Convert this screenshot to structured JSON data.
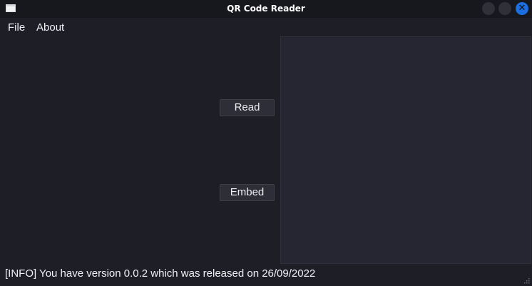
{
  "window": {
    "title": "QR Code Reader"
  },
  "titlebar_buttons": {
    "close_glyph": "✕"
  },
  "menu": {
    "items": [
      "File",
      "About"
    ]
  },
  "actions": {
    "read_label": "Read",
    "embed_label": "Embed"
  },
  "status": {
    "text": "[INFO] You have version 0.0.2 which was released on 26/09/2022"
  },
  "colors": {
    "background": "#1e1f26",
    "preview_panel": "#252631",
    "close_button": "#1b6fe0"
  }
}
